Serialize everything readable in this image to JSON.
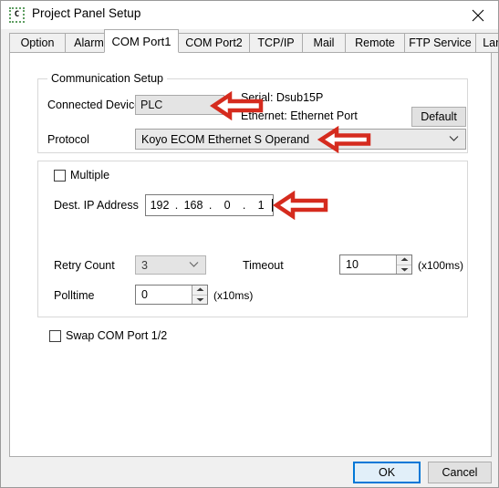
{
  "window": {
    "title": "Project Panel Setup",
    "icon": "app-c-icon",
    "icon_glyph": "C",
    "close_label": "✕"
  },
  "tabs": [
    {
      "label": "Option",
      "active": false
    },
    {
      "label": "Alarm",
      "active": false
    },
    {
      "label": "COM Port1",
      "active": true
    },
    {
      "label": "COM Port2",
      "active": false
    },
    {
      "label": "TCP/IP",
      "active": false
    },
    {
      "label": "Mail",
      "active": false
    },
    {
      "label": "Remote",
      "active": false
    },
    {
      "label": "FTP Service",
      "active": false
    },
    {
      "label": "Language",
      "active": false
    }
  ],
  "communication_setup": {
    "legend": "Communication Setup",
    "connected_device": {
      "label": "Connected Device",
      "value": "PLC",
      "disabled": true
    },
    "port_info": {
      "serial": "Serial: Dsub15P",
      "ethernet": "Ethernet: Ethernet Port"
    },
    "default_button": "Default",
    "protocol": {
      "label": "Protocol",
      "value": "Koyo ECOM Ethernet S Operand"
    }
  },
  "connection_panel": {
    "multiple": {
      "label": "Multiple",
      "checked": false
    },
    "dest_ip": {
      "label": "Dest.  IP Address",
      "octets": [
        "192",
        "168",
        "0",
        "1"
      ],
      "separator": "."
    },
    "retry_count": {
      "label": "Retry Count",
      "value": "3",
      "disabled": true
    },
    "timeout": {
      "label": "Timeout",
      "value": "10",
      "units": "(x100ms)"
    },
    "polltime": {
      "label": "Polltime",
      "value": "0",
      "units": "(x10ms)"
    }
  },
  "swap_com_port": {
    "label": "Swap COM Port 1/2",
    "checked": false
  },
  "footer": {
    "ok_label": "OK",
    "cancel_label": "Cancel"
  },
  "annotations": {
    "arrow_color": "#d52b1e",
    "arrow_fill": "#ffffff",
    "items": [
      {
        "name": "arrow-connected-device",
        "points_to": "connected-device-field"
      },
      {
        "name": "arrow-protocol",
        "points_to": "protocol-combo"
      },
      {
        "name": "arrow-dest-ip",
        "points_to": "dest-ip-field"
      }
    ]
  },
  "colors": {
    "dialog_bg": "#f0f0f0",
    "page_bg": "#ffffff",
    "focus_blue": "#0078d7",
    "accent_red": "#d52b1e"
  }
}
